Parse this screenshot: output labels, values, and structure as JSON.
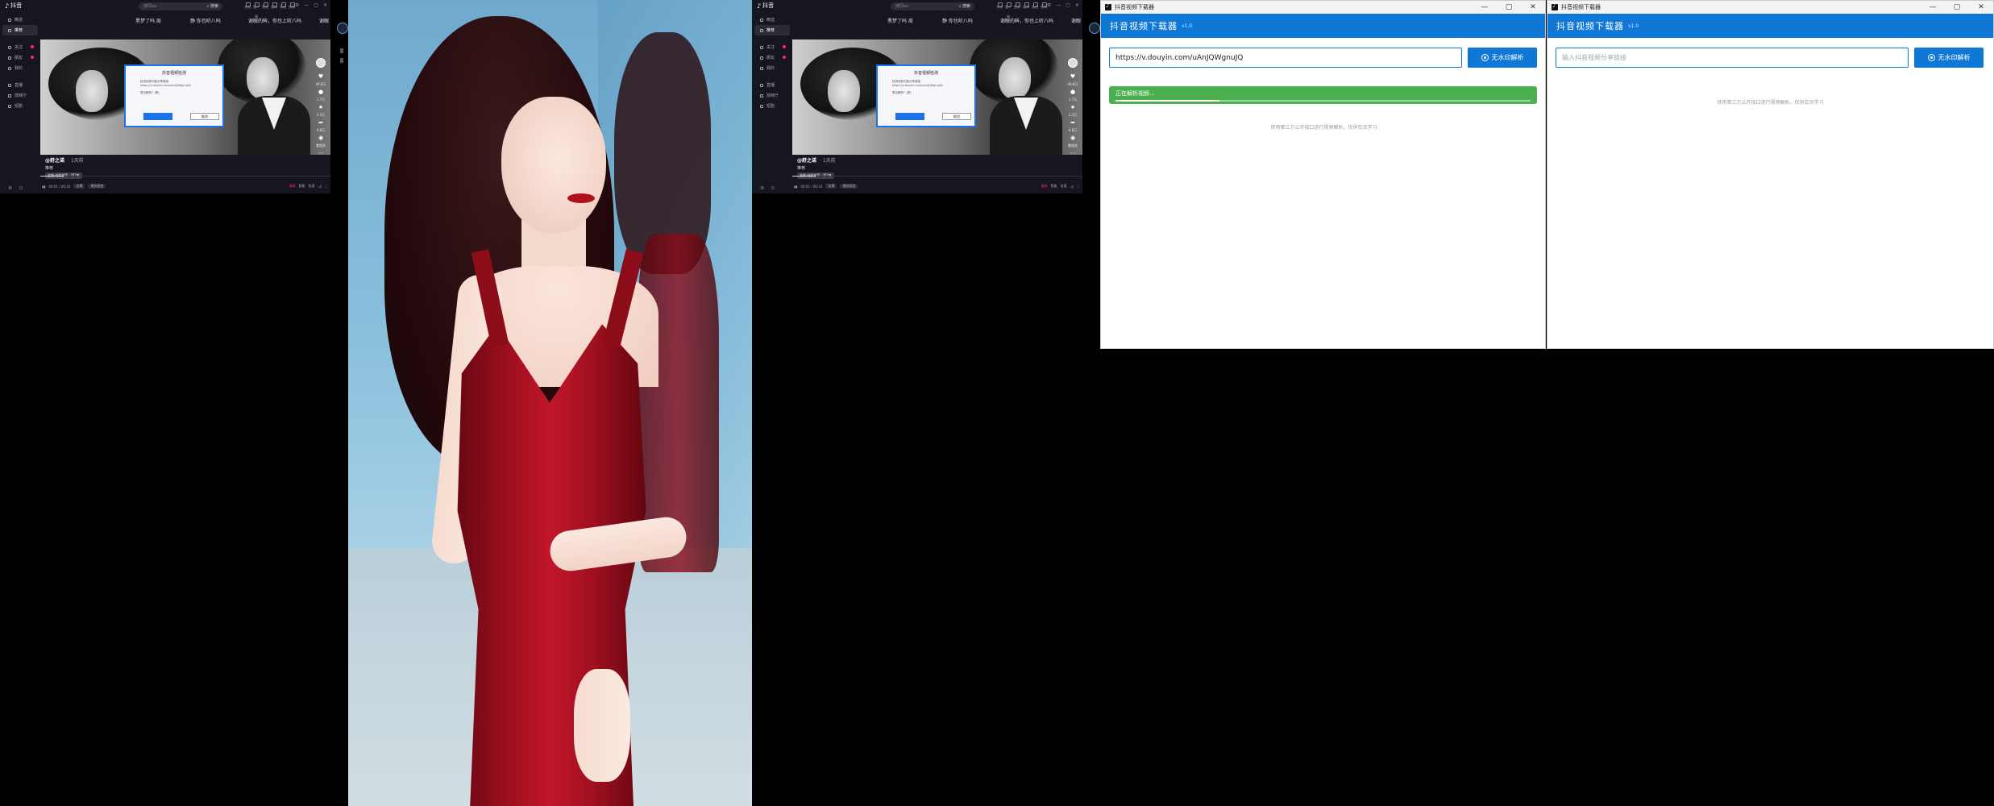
{
  "douyin": {
    "logo": "抖音",
    "search_placeholder": "搜同ou",
    "search_button": "搜索",
    "top_icons": [
      "充钻",
      "客户端",
      "壁纸",
      "通知",
      "私信",
      "投稿"
    ],
    "sidebar": [
      {
        "label": "精选",
        "icon": "home-icon"
      },
      {
        "label": "推荐",
        "icon": "recommend-icon",
        "active": true
      },
      {
        "label": "关注",
        "icon": "follow-icon"
      },
      {
        "label": "朋友",
        "icon": "friend-icon"
      },
      {
        "label": "我的",
        "icon": "user-icon"
      },
      {
        "label": "直播",
        "icon": "live-icon"
      },
      {
        "label": "放映厅",
        "icon": "cinema-icon"
      },
      {
        "label": "短剧",
        "icon": "drama-icon"
      }
    ],
    "marquee": [
      "黑梦了吗 周",
      "静 你也听八吗",
      "谢眼的眸，你也上听八吗",
      "谢眼"
    ],
    "video": {
      "author": "@舒之诺",
      "time": "· 1天前",
      "desc": "推荐",
      "chip": "合集·电影推荐 · 第1集",
      "likes": "46.8万",
      "comments": "1.7万",
      "stars": "2.3万",
      "shares": "4.8万",
      "follow": "看相关"
    },
    "controls": {
      "time": "00:01 / 00:10",
      "pill1": "连播",
      "pill2": "播放速度",
      "clear": "清屏",
      "quality": "智能",
      "speed": "倍速",
      "progress": 0.08
    },
    "dialog": {
      "title": "抖音视频检测",
      "body": "检测到剪切板分享链接",
      "link": "https://v.douyin.com/uAnJQWgnuJQ/",
      "question": "是否解析？(是)",
      "ok": "",
      "cancel": "取消"
    }
  },
  "downloader": {
    "window_title": "抖音视频下载器",
    "app_name": "抖音视频下载器",
    "version": "v1.0",
    "button": "无水印解析",
    "input_value": "https://v.douyin.com/uAnJQWgnuJQ",
    "input_placeholder": "输入抖音视频分享链接",
    "status": "正在解析视频...",
    "progress": 0.25,
    "footer": "使用第三方公开接口进行视频解析。仅供交流学习"
  },
  "colors": {
    "accent": "#0f78d7",
    "status_green": "#4caf50",
    "douyin_red": "#fe2c55"
  }
}
